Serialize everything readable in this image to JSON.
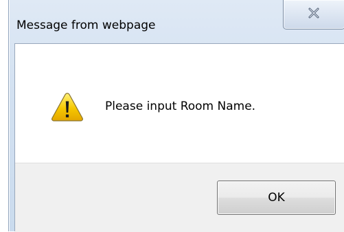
{
  "dialog": {
    "title": "Message from webpage",
    "message": "Please input Room Name.",
    "ok_label": "OK",
    "icon": "warning-icon",
    "close_icon": "close-icon"
  },
  "colors": {
    "frame": "#d3e1f1",
    "button_strip": "#f0f0f0",
    "warning_fill": "#f6c700",
    "warning_outline": "#7a6a3a"
  }
}
